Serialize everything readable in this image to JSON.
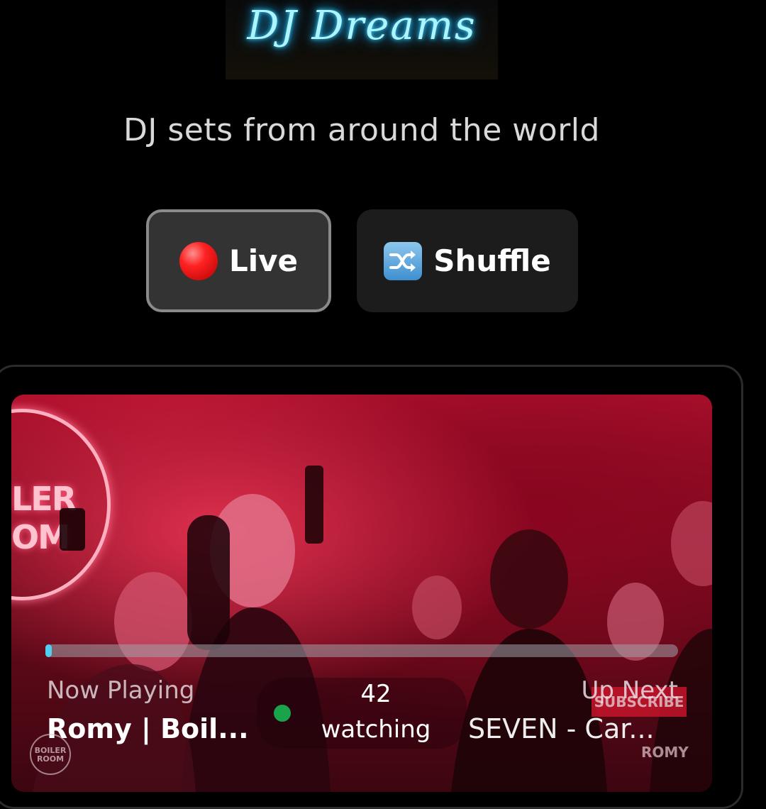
{
  "header": {
    "logo_text": "DJ Dreams",
    "tagline": "DJ sets from around the world"
  },
  "controls": {
    "live_label": "Live",
    "shuffle_label": "Shuffle"
  },
  "player": {
    "progress_fraction": 0.01,
    "now_playing_label": "Now Playing",
    "now_playing_title": "Romy | Boil...",
    "watching_count": "42",
    "watching_label": "watching",
    "up_next_label": "Up Next",
    "up_next_title": "SEVEN - Car...",
    "video_overlay": {
      "neon_sign_text": "LER\nOM",
      "subscribe_badge": "SUBSCRIBE",
      "watermark": "ROMY",
      "boiler_room_logo": "BOILER ROOM"
    }
  },
  "icons": {
    "live": "red-circle-icon",
    "shuffle": "shuffle-icon"
  },
  "colors": {
    "background": "#000000",
    "live_button_bg": "#333333",
    "live_button_border": "#8a8a8a",
    "shuffle_button_bg": "#1c1c1c",
    "progress_fill": "#4fd0f0",
    "watching_dot": "#1aa34a",
    "logo_glow": "#37d2ff"
  }
}
